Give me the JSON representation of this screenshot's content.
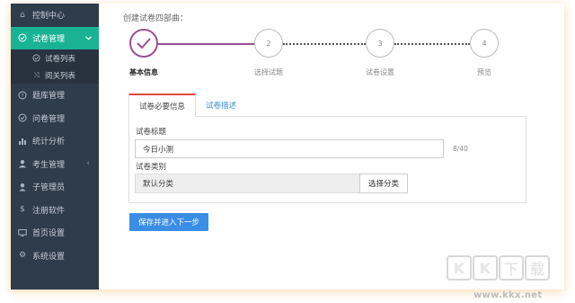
{
  "sidebar": {
    "items": [
      {
        "icon": "home-icon",
        "label": "控制中心"
      },
      {
        "icon": "check-circle-icon",
        "label": "试卷管理",
        "active": true
      },
      {
        "icon": "help-circle-icon",
        "label": "题库管理"
      },
      {
        "icon": "check-circle-outline-icon",
        "label": "问卷管理"
      },
      {
        "icon": "bar-chart-icon",
        "label": "统计分析"
      },
      {
        "icon": "user-icon",
        "label": "考生管理"
      },
      {
        "icon": "user-single-icon",
        "label": "子管理员"
      },
      {
        "icon": "dollar-icon",
        "label": "注册软件"
      },
      {
        "icon": "monitor-icon",
        "label": "首页设置"
      },
      {
        "icon": "gear-icon",
        "label": "系统设置"
      }
    ],
    "sub_items": [
      {
        "icon": "check-circle-icon",
        "label": "试卷列表"
      },
      {
        "icon": "shuffle-icon",
        "label": "阅关列表"
      }
    ]
  },
  "main": {
    "section_title": "创建试卷四部曲：",
    "steps": [
      {
        "number": "",
        "label": "基本信息",
        "done": true
      },
      {
        "number": "2",
        "label": "选择试题"
      },
      {
        "number": "3",
        "label": "试卷设置"
      },
      {
        "number": "4",
        "label": "预览"
      }
    ],
    "tabs": [
      "试卷必要信息",
      "试卷描述"
    ],
    "form": {
      "title_label": "试卷标题",
      "title_value": "今日小测",
      "title_counter": "8/40",
      "category_label": "试卷类别",
      "category_value": "默认分类",
      "choose_category_button": "选择分类"
    },
    "save_button": "保存并进入下一步"
  },
  "watermark": {
    "letters": [
      "K",
      "K",
      "下",
      "载"
    ],
    "url": "www.kkx.net"
  },
  "colors": {
    "sidebar_bg": "#2f3c4a",
    "active_nav": "#19b394",
    "step_accent": "#9b4f96",
    "primary_button": "#3a8ee6",
    "active_tab_border": "#e04a3f"
  }
}
